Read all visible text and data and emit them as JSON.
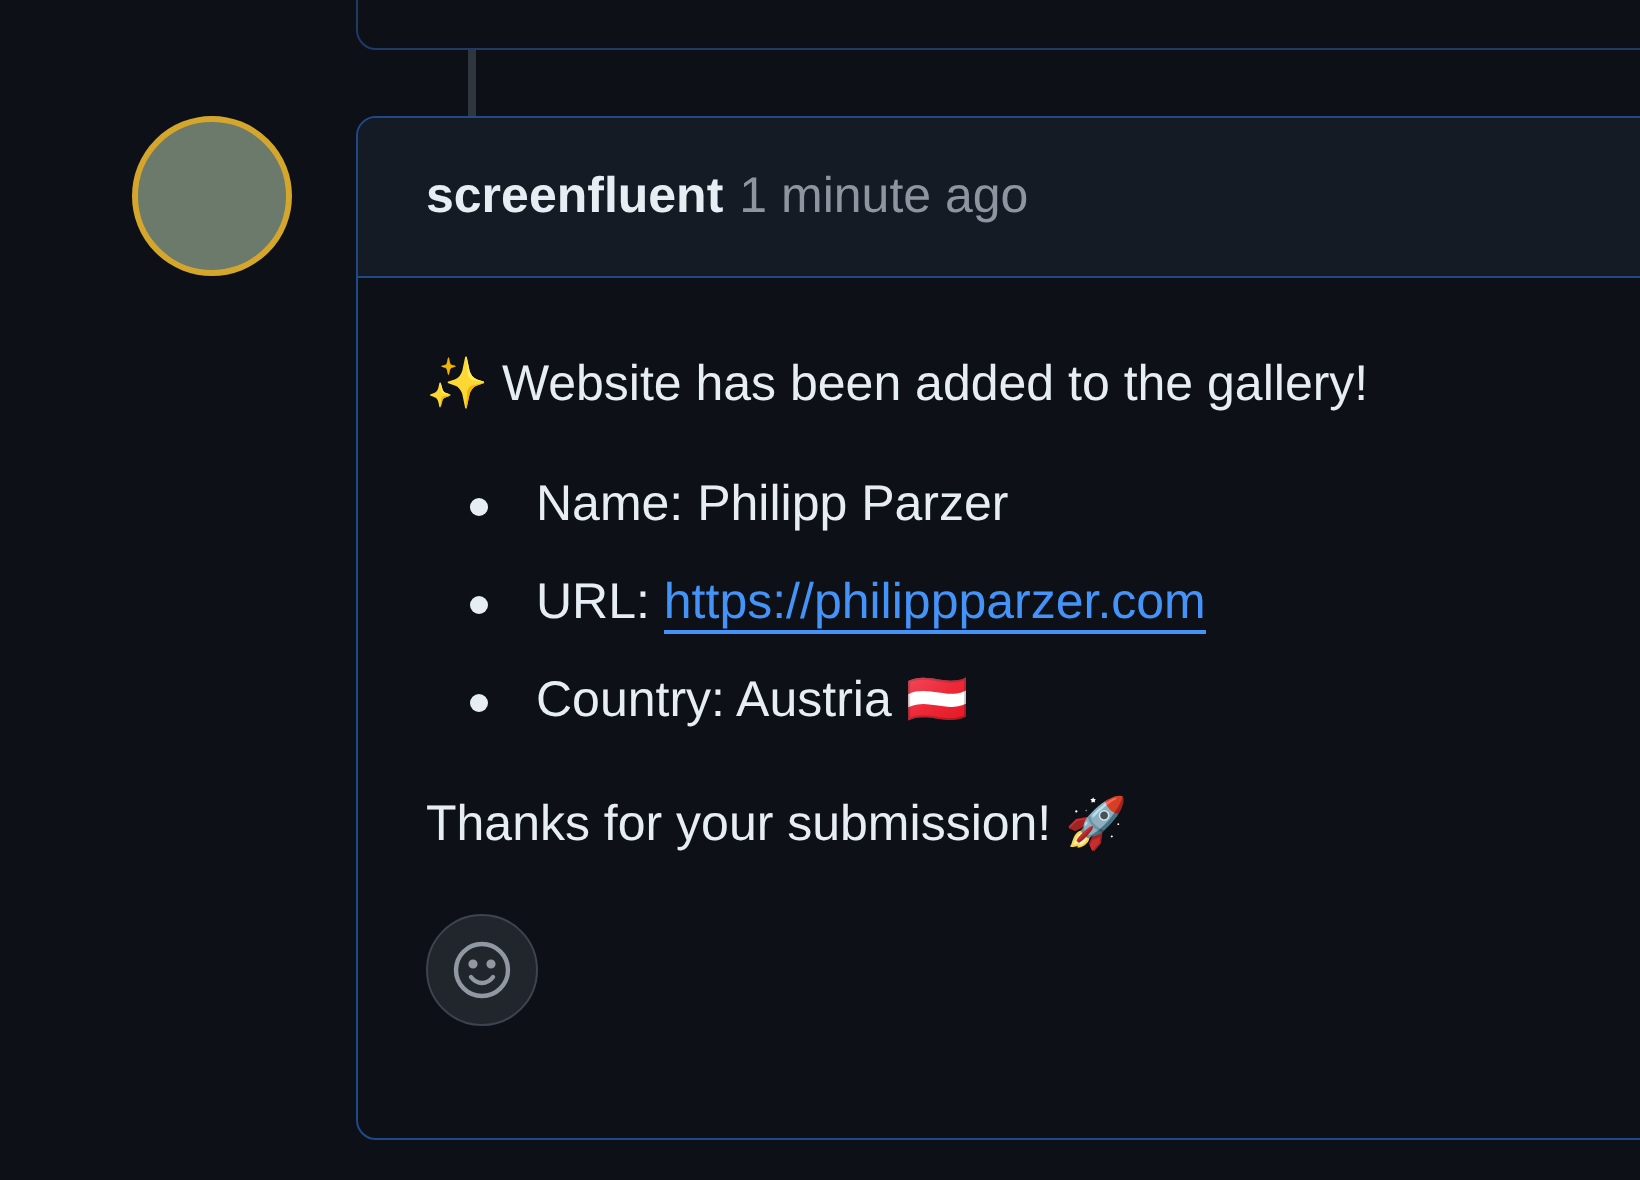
{
  "comment": {
    "author": "screenfluent",
    "time": "1 minute ago",
    "intro": "✨ Website has been added to the gallery!",
    "items": [
      {
        "kind": "text",
        "label": "Name:",
        "value": "Philipp Parzer"
      },
      {
        "kind": "link",
        "label": "URL:",
        "value": "https://philippparzer.com"
      },
      {
        "kind": "text",
        "label": "Country:",
        "value": "Austria 🇦🇹"
      }
    ],
    "outro": "Thanks for your submission! 🚀"
  }
}
